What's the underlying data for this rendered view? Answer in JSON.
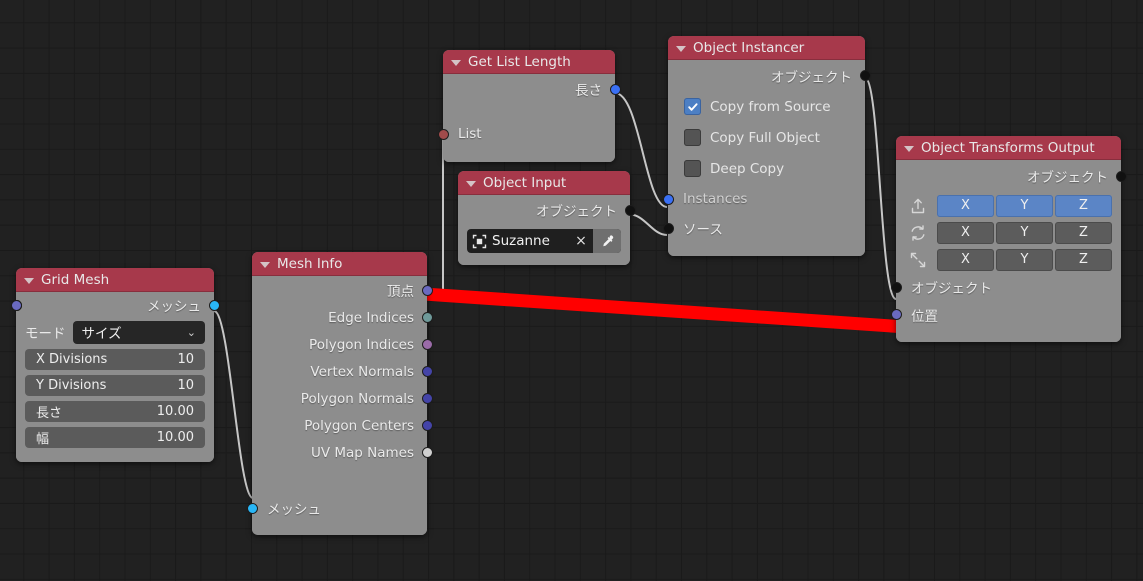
{
  "editor": {
    "name": "node-editor",
    "background_color": "#212121",
    "grid_color": "#1a1a1a"
  },
  "colors": {
    "header": "#a7394b",
    "body": "#8d8d8d",
    "wire": "#c6c6c6",
    "annotation": "#ff0000",
    "socket_geometry": "#29b6f6",
    "socket_integer": "#3a70f5",
    "socket_float": "#6a6ac0",
    "socket_object": "#111111",
    "socket_list": "#a14b4b",
    "socket_edge": "#6f9a9a",
    "socket_polygon": "#9a6ba8",
    "socket_string": "#d0d0d0",
    "checkbox_on": "#4c7fc4",
    "button_on": "#5b85c6"
  },
  "nodes": {
    "grid_mesh": {
      "title": "Grid Mesh",
      "outputs": [
        {
          "label": "メッシュ",
          "socket": "geometry"
        }
      ],
      "mode": {
        "label": "モード",
        "value": "サイズ",
        "chevron": "chevron-down-icon"
      },
      "fields": [
        {
          "label": "X Divisions",
          "value": "10",
          "socket": "integer"
        },
        {
          "label": "Y Divisions",
          "value": "10",
          "socket": "integer"
        },
        {
          "label": "長さ",
          "value": "10.00",
          "socket": "float"
        },
        {
          "label": "幅",
          "value": "10.00",
          "socket": "float"
        }
      ]
    },
    "mesh_info": {
      "title": "Mesh Info",
      "outputs": [
        {
          "label": "頂点",
          "socket": "float"
        },
        {
          "label": "Edge Indices",
          "socket": "edge"
        },
        {
          "label": "Polygon Indices",
          "socket": "polygon"
        },
        {
          "label": "Vertex Normals",
          "socket": "float"
        },
        {
          "label": "Polygon Normals",
          "socket": "float"
        },
        {
          "label": "Polygon Centers",
          "socket": "float"
        },
        {
          "label": "UV Map Names",
          "socket": "string"
        }
      ],
      "inputs": [
        {
          "label": "メッシュ",
          "socket": "geometry"
        }
      ]
    },
    "get_list_length": {
      "title": "Get List Length",
      "outputs": [
        {
          "label": "長さ",
          "socket": "integer"
        }
      ],
      "inputs": [
        {
          "label": "List",
          "socket": "list"
        }
      ]
    },
    "object_input": {
      "title": "Object Input",
      "outputs": [
        {
          "label": "オブジェクト",
          "socket": "object"
        }
      ],
      "object_field": {
        "icon": "object-square-icon",
        "name": "Suzanne",
        "clear": "×",
        "picker": "eyedropper-icon"
      }
    },
    "object_instancer": {
      "title": "Object Instancer",
      "outputs": [
        {
          "label": "オブジェクト",
          "socket": "object"
        }
      ],
      "checkboxes": [
        {
          "label": "Copy from Source",
          "checked": true
        },
        {
          "label": "Copy Full Object",
          "checked": false
        },
        {
          "label": "Deep Copy",
          "checked": false
        }
      ],
      "inputs": [
        {
          "label": "Instances",
          "socket": "integer"
        },
        {
          "label": "ソース",
          "socket": "object"
        }
      ]
    },
    "object_transforms_output": {
      "title": "Object Transforms Output",
      "outputs": [
        {
          "label": "オブジェクト",
          "socket": "object"
        }
      ],
      "transform_rows": [
        {
          "icon": "move-icon",
          "axes": [
            {
              "label": "X",
              "on": true
            },
            {
              "label": "Y",
              "on": true
            },
            {
              "label": "Z",
              "on": true
            }
          ]
        },
        {
          "icon": "rotate-icon",
          "axes": [
            {
              "label": "X",
              "on": false
            },
            {
              "label": "Y",
              "on": false
            },
            {
              "label": "Z",
              "on": false
            }
          ]
        },
        {
          "icon": "scale-icon",
          "axes": [
            {
              "label": "X",
              "on": false
            },
            {
              "label": "Y",
              "on": false
            },
            {
              "label": "Z",
              "on": false
            }
          ]
        }
      ],
      "inputs": [
        {
          "label": "オブジェクト",
          "socket": "object"
        },
        {
          "label": "位置",
          "socket": "float"
        }
      ]
    }
  },
  "annotation": {
    "name": "red-highlight-line",
    "from": "頂点",
    "to": "位置",
    "color": "#ff0000"
  }
}
